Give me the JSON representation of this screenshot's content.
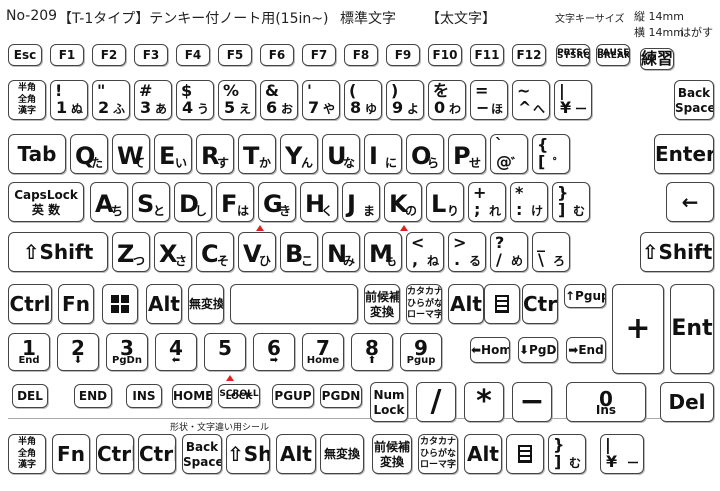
{
  "header": {
    "model": "No-209",
    "title": "【T-1タイプ】テンキー付ノート用(15in~)",
    "style": "標準文字",
    "weight": "【太文字】",
    "size_label": "文字キーサイズ",
    "size_v": "縦 14mm",
    "size_h": "横 14mm",
    "peel": "はがす"
  },
  "separator_label": "形状・文字違い用シール",
  "rows": {
    "r1": [
      {
        "t": "Esc"
      },
      {
        "t": "F1"
      },
      {
        "t": "F2"
      },
      {
        "t": "F3"
      },
      {
        "t": "F4"
      },
      {
        "t": "F5"
      },
      {
        "t": "F6"
      },
      {
        "t": "F7"
      },
      {
        "t": "F8"
      },
      {
        "t": "F9"
      },
      {
        "t": "F10"
      },
      {
        "t": "F11"
      },
      {
        "t": "F12"
      },
      {
        "t": "PRTSC",
        "b": "SYSRQ"
      },
      {
        "t": "PAUSE",
        "b": "BREAK"
      },
      {
        "t": "練習"
      }
    ],
    "r2": [
      {
        "t": "半角",
        "b": "全角",
        "c": "漢字"
      },
      {
        "t": "!",
        "s": "1",
        "k": "ぬ"
      },
      {
        "t": "\"",
        "s": "2",
        "k": "ふ"
      },
      {
        "t": "#",
        "s": "3",
        "k": "あ"
      },
      {
        "t": "$",
        "s": "4",
        "k": "う"
      },
      {
        "t": "%",
        "s": "5",
        "k": "え"
      },
      {
        "t": "&",
        "s": "6",
        "k": "お"
      },
      {
        "t": "'",
        "s": "7",
        "k": "や"
      },
      {
        "t": "(",
        "s": "8",
        "k": "ゆ"
      },
      {
        "t": ")",
        "s": "9",
        "k": "よ"
      },
      {
        "t": "を",
        "s": "0",
        "k": "わ"
      },
      {
        "t": "=",
        "s": "−",
        "k": "ほ"
      },
      {
        "t": "~",
        "s": "^",
        "k": "へ"
      },
      {
        "t": "|",
        "s": "¥",
        "k": "ー"
      },
      {
        "t": "Back",
        "b": "Space"
      }
    ],
    "r3": [
      {
        "t": "Tab"
      },
      {
        "t": "Q",
        "k": "た"
      },
      {
        "t": "W",
        "k": "て"
      },
      {
        "t": "E",
        "k": "い"
      },
      {
        "t": "R",
        "k": "す"
      },
      {
        "t": "T",
        "k": "か"
      },
      {
        "t": "Y",
        "k": "ん"
      },
      {
        "t": "U",
        "k": "な"
      },
      {
        "t": "I",
        "k": "に"
      },
      {
        "t": "O",
        "k": "ら"
      },
      {
        "t": "P",
        "k": "せ"
      },
      {
        "t": "`",
        "s": "@",
        "k": "゛"
      },
      {
        "t": "{",
        "s": "[",
        "k": "゜"
      },
      {
        "t": "Enter"
      }
    ],
    "r4": [
      {
        "t": "CapsLock",
        "b": "英 数"
      },
      {
        "t": "A",
        "k": "ち"
      },
      {
        "t": "S",
        "k": "と"
      },
      {
        "t": "D",
        "k": "し"
      },
      {
        "t": "F",
        "k": "は"
      },
      {
        "t": "G",
        "k": "き"
      },
      {
        "t": "H",
        "k": "く"
      },
      {
        "t": "J",
        "k": "ま"
      },
      {
        "t": "K",
        "k": "の"
      },
      {
        "t": "L",
        "k": "り"
      },
      {
        "t": "+",
        "s": ";",
        "k": "れ"
      },
      {
        "t": "*",
        "s": ":",
        "k": "け"
      },
      {
        "t": "}",
        "s": "]",
        "k": "む"
      }
    ],
    "r5": [
      {
        "t": "⇧Shift"
      },
      {
        "t": "Z",
        "k": "つ"
      },
      {
        "t": "X",
        "k": "さ"
      },
      {
        "t": "C",
        "k": "そ"
      },
      {
        "t": "V",
        "k": "ひ"
      },
      {
        "t": "B",
        "k": "こ"
      },
      {
        "t": "N",
        "k": "み"
      },
      {
        "t": "M",
        "k": "も"
      },
      {
        "t": "<",
        "s": ",",
        "k": "ね"
      },
      {
        "t": ">",
        "s": ".",
        "k": "る"
      },
      {
        "t": "?",
        "s": "/",
        "k": "め"
      },
      {
        "t": "_",
        "s": "\\",
        "k": "ろ"
      },
      {
        "t": "⇧Shift"
      }
    ],
    "r6": [
      {
        "t": "Ctrl"
      },
      {
        "t": "Fn"
      },
      {
        "t": "win"
      },
      {
        "t": "Alt"
      },
      {
        "t": "無変換"
      },
      {
        "t": ""
      },
      {
        "t": "前候補",
        "b": "変換"
      },
      {
        "t": "カタカナ",
        "b": "ひらがな",
        "c": "ローマ字"
      },
      {
        "t": "Alt"
      },
      {
        "t": "menu"
      },
      {
        "t": "Ctrl"
      },
      {
        "t": "↑Pgup"
      }
    ],
    "r7": [
      {
        "t": "1",
        "b": "End"
      },
      {
        "t": "2",
        "b": "⬇"
      },
      {
        "t": "3",
        "b": "PgDn"
      },
      {
        "t": "4",
        "b": "⬅"
      },
      {
        "t": "5"
      },
      {
        "t": "6",
        "b": "➡"
      },
      {
        "t": "7",
        "b": "Home"
      },
      {
        "t": "8",
        "b": "⬆"
      },
      {
        "t": "9",
        "b": "Pgup"
      },
      {
        "t": "⬅Home"
      },
      {
        "t": "⬇PgDn"
      },
      {
        "t": "➡End"
      }
    ],
    "r8": [
      {
        "t": "DEL"
      },
      {
        "t": "END"
      },
      {
        "t": "INS"
      },
      {
        "t": "HOME"
      },
      {
        "t": "SCROLL",
        "b": "LOCK"
      },
      {
        "t": "PGUP"
      },
      {
        "t": "PGDN"
      },
      {
        "t": "Num",
        "b": "Lock"
      },
      {
        "t": "/"
      },
      {
        "t": "*"
      },
      {
        "t": "−"
      },
      {
        "t": "0",
        "b": "Ins"
      },
      {
        "t": "Del"
      }
    ],
    "numpad": [
      {
        "t": "+"
      },
      {
        "t": "Ent"
      }
    ],
    "r9": [
      {
        "t": "半角",
        "b": "全角",
        "c": "漢字"
      },
      {
        "t": "Fn"
      },
      {
        "t": "Ctrl"
      },
      {
        "t": "Ctrl"
      },
      {
        "t": "Back",
        "b": "Space"
      },
      {
        "t": "⇧Shift"
      },
      {
        "t": "Alt"
      },
      {
        "t": "無変換"
      },
      {
        "t": "前候補",
        "b": "変換"
      },
      {
        "t": "カタカナ",
        "b": "ひらがな",
        "c": "ローマ字"
      },
      {
        "t": "Alt"
      },
      {
        "t": "menu"
      },
      {
        "t": "}",
        "s": "]",
        "k": "む"
      },
      {
        "t": "|",
        "s": "¥",
        "k": "ー"
      }
    ]
  },
  "colors": {
    "marker": "#e02020",
    "border": "#444444"
  }
}
